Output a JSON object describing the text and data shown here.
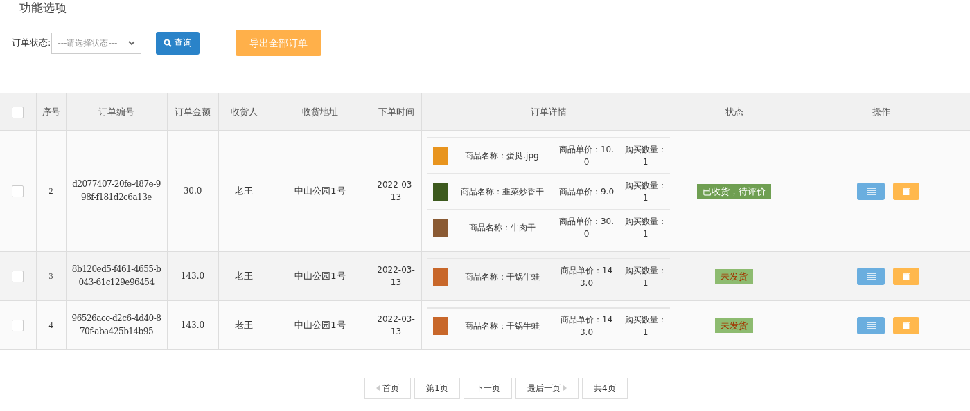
{
  "section_title": "功能选项",
  "filter": {
    "label": "订单状态:",
    "placeholder": "---请选择状态---"
  },
  "search_button": "查询",
  "export_button": "导出全部订单",
  "table": {
    "select_all": {
      "checked": false
    },
    "columns": [
      "序号",
      "订单编号",
      "订单金额",
      "收货人",
      "收货地址",
      "下单时间",
      "订单详情",
      "状态",
      "操作"
    ],
    "rows": [
      {
        "checked": false,
        "index": "2",
        "order_no": "d2077407-20fe-487e-998f-f181d2c6a13e",
        "amount": "30.0",
        "receiver": "老王",
        "address": "中山公园1号",
        "time": "2022-03-13",
        "items": [
          {
            "name": "商品名称：蛋挞.jpg",
            "price": "商品单价：10.0",
            "qty": "购买数量：1"
          },
          {
            "name": "商品名称：韭菜炒香干",
            "price": "商品单价：9.0",
            "qty": "购买数量：1"
          },
          {
            "name": "商品名称：牛肉干",
            "price": "商品单价：30.0",
            "qty": "购买数量：1"
          }
        ],
        "status": {
          "text": "已收货，待评价",
          "kind": "received"
        }
      },
      {
        "checked": false,
        "index": "3",
        "order_no": "8b120ed5-f461-4655-b043-61c129e96454",
        "amount": "143.0",
        "receiver": "老王",
        "address": "中山公园1号",
        "time": "2022-03-13",
        "items": [
          {
            "name": "商品名称：干锅牛蛙",
            "price": "商品单价：143.0",
            "qty": "购买数量：1"
          }
        ],
        "status": {
          "text": "未发货",
          "kind": "pending"
        }
      },
      {
        "checked": false,
        "index": "4",
        "order_no": "96526acc-d2c6-4d40-870f-aba425b14b95",
        "amount": "143.0",
        "receiver": "老王",
        "address": "中山公园1号",
        "time": "2022-03-13",
        "items": [
          {
            "name": "商品名称：干锅牛蛙",
            "price": "商品单价：143.0",
            "qty": "购买数量：1"
          }
        ],
        "status": {
          "text": "未发货",
          "kind": "pending"
        }
      }
    ]
  },
  "pagination": [
    {
      "label": "首页",
      "kind": "first"
    },
    {
      "label": "第1页",
      "kind": "plain"
    },
    {
      "label": "下一页",
      "kind": "plain"
    },
    {
      "label": "最后一页",
      "kind": "last"
    },
    {
      "label": "共4页",
      "kind": "plain"
    }
  ]
}
